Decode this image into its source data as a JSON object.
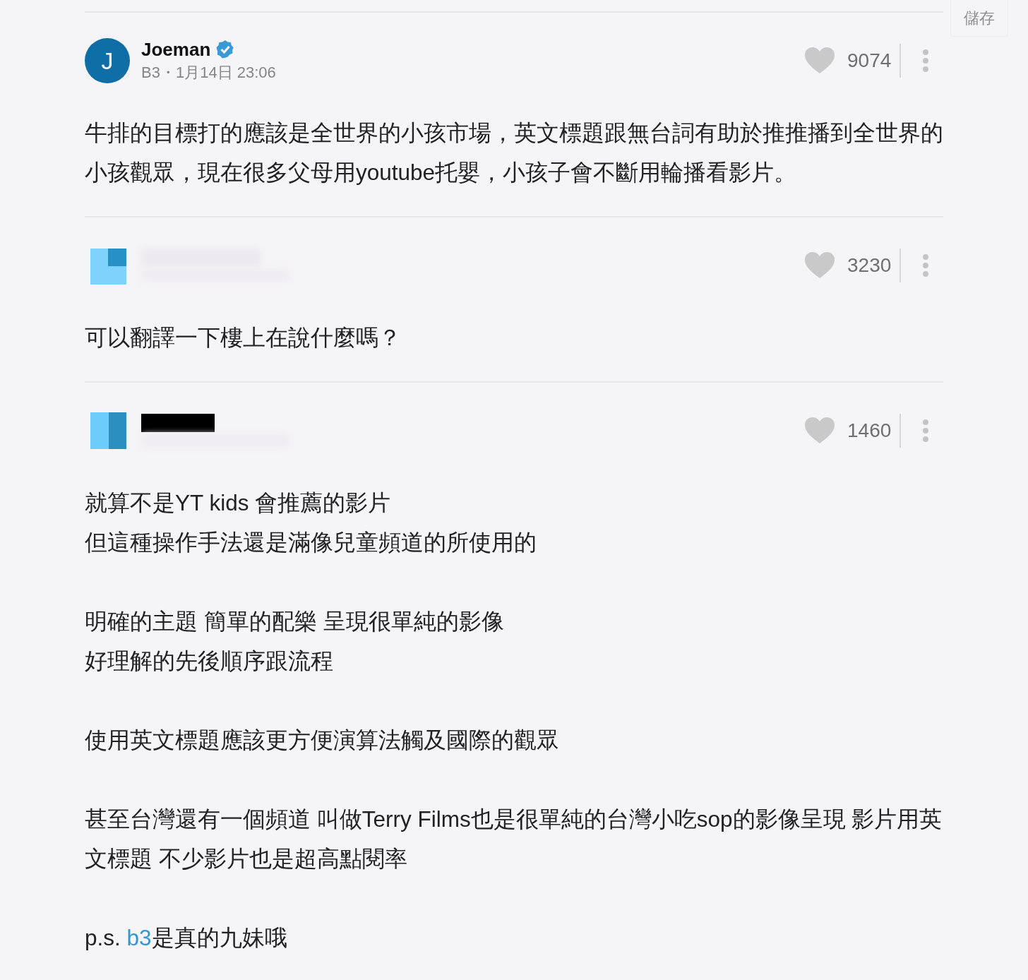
{
  "save_button": {
    "label": "儲存"
  },
  "comments": [
    {
      "avatar": {
        "kind": "letter",
        "letter": "J"
      },
      "kind": "named",
      "author": "Joeman",
      "verified": true,
      "meta": "B3・1月14日 23:06",
      "likes": "9074",
      "paragraphs": [
        {
          "kind": "text",
          "lines": [
            "牛排的目標打的應該是全世界的小孩市場，英文標題跟無台詞有助於推推播到全世界的小孩觀眾，現在很多父母用youtube托嬰，小孩子會不斷用輪播看影片。"
          ]
        }
      ]
    },
    {
      "avatar": {
        "kind": "quarter"
      },
      "kind": "blurred",
      "likes": "3230",
      "paragraphs": [
        {
          "kind": "text",
          "lines": [
            "可以翻譯一下樓上在說什麼嗎？"
          ]
        }
      ]
    },
    {
      "avatar": {
        "kind": "half"
      },
      "kind": "redacted",
      "likes": "1460",
      "paragraphs": [
        {
          "kind": "text",
          "lines": [
            "就算不是YT kids 會推薦的影片",
            "但這種操作手法還是滿像兒童頻道的所使用的"
          ]
        },
        {
          "kind": "text",
          "lines": [
            "明確的主題  簡單的配樂  呈現很單純的影像",
            "好理解的先後順序跟流程"
          ]
        },
        {
          "kind": "text",
          "lines": [
            "使用英文標題應該更方便演算法觸及國際的觀眾"
          ]
        },
        {
          "kind": "text",
          "lines": [
            "甚至台灣還有一個頻道  叫做Terry Films也是很單純的台灣小吃sop的影像呈現  影片用英文標題  不少影片也是超高點閱率"
          ]
        },
        {
          "kind": "mention",
          "before": "p.s. ",
          "link": "b3",
          "after": "是真的九妹哦"
        }
      ]
    }
  ]
}
